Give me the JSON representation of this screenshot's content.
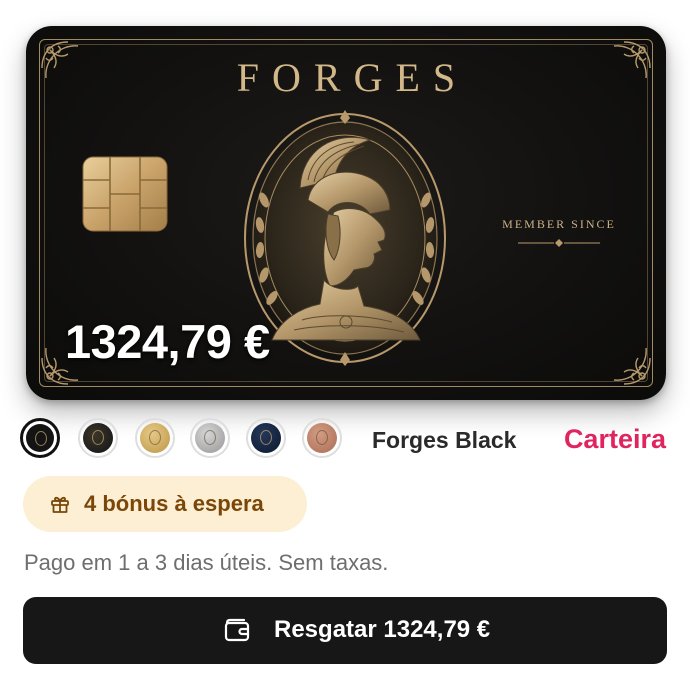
{
  "card": {
    "brand": "FORGES",
    "member_since_label": "MEMBER SINCE",
    "balance": "1324,79 €",
    "face_color": "#121110",
    "accent_gold": "#d2b889"
  },
  "card_selector": {
    "swatches": [
      {
        "name": "black",
        "color": "#111111",
        "selected": true
      },
      {
        "name": "black-gold-flecks",
        "color": "#1e1e1c",
        "selected": false
      },
      {
        "name": "gold",
        "color": "#c9a55a",
        "selected": false
      },
      {
        "name": "silver",
        "color": "#a9a9a9",
        "selected": false
      },
      {
        "name": "navy",
        "color": "#14223b",
        "selected": false
      },
      {
        "name": "rose-gold",
        "color": "#b57a62",
        "selected": false
      }
    ],
    "selected_name": "Forges Black",
    "wallet_link": "Carteira",
    "wallet_link_color": "#e0245e"
  },
  "bonus": {
    "label": "4 bónus à espera",
    "icon": "gift-icon",
    "background": "#fdefd3",
    "text_color": "#7a4708"
  },
  "info": {
    "text": "Pago em 1 a 3 dias úteis. Sem taxas."
  },
  "cta": {
    "label": "Resgatar 1324,79 €",
    "icon": "wallet-icon",
    "background": "#171717"
  }
}
